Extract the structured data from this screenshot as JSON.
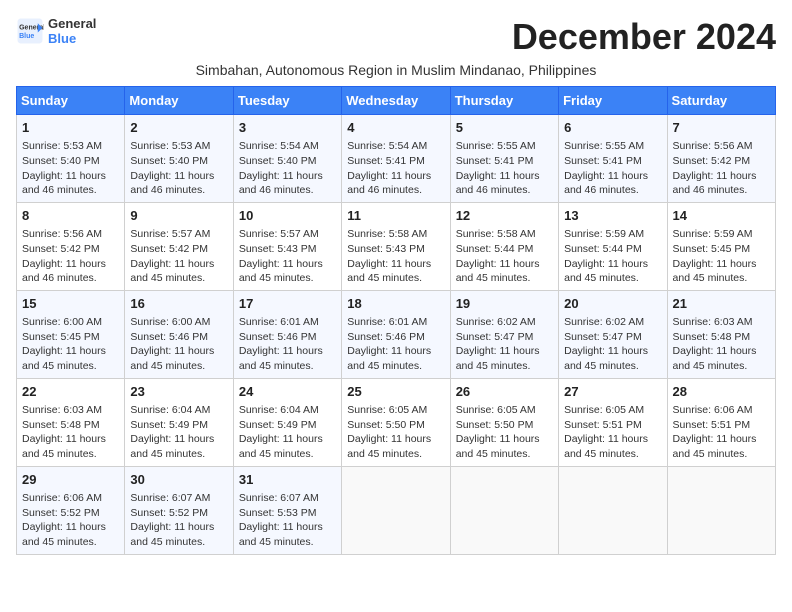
{
  "header": {
    "logo_line1": "General",
    "logo_line2": "Blue",
    "month_title": "December 2024",
    "subtitle": "Simbahan, Autonomous Region in Muslim Mindanao, Philippines"
  },
  "days_of_week": [
    "Sunday",
    "Monday",
    "Tuesday",
    "Wednesday",
    "Thursday",
    "Friday",
    "Saturday"
  ],
  "weeks": [
    [
      {
        "day": "1",
        "sunrise": "Sunrise: 5:53 AM",
        "sunset": "Sunset: 5:40 PM",
        "daylight": "Daylight: 11 hours and 46 minutes."
      },
      {
        "day": "2",
        "sunrise": "Sunrise: 5:53 AM",
        "sunset": "Sunset: 5:40 PM",
        "daylight": "Daylight: 11 hours and 46 minutes."
      },
      {
        "day": "3",
        "sunrise": "Sunrise: 5:54 AM",
        "sunset": "Sunset: 5:40 PM",
        "daylight": "Daylight: 11 hours and 46 minutes."
      },
      {
        "day": "4",
        "sunrise": "Sunrise: 5:54 AM",
        "sunset": "Sunset: 5:41 PM",
        "daylight": "Daylight: 11 hours and 46 minutes."
      },
      {
        "day": "5",
        "sunrise": "Sunrise: 5:55 AM",
        "sunset": "Sunset: 5:41 PM",
        "daylight": "Daylight: 11 hours and 46 minutes."
      },
      {
        "day": "6",
        "sunrise": "Sunrise: 5:55 AM",
        "sunset": "Sunset: 5:41 PM",
        "daylight": "Daylight: 11 hours and 46 minutes."
      },
      {
        "day": "7",
        "sunrise": "Sunrise: 5:56 AM",
        "sunset": "Sunset: 5:42 PM",
        "daylight": "Daylight: 11 hours and 46 minutes."
      }
    ],
    [
      {
        "day": "8",
        "sunrise": "Sunrise: 5:56 AM",
        "sunset": "Sunset: 5:42 PM",
        "daylight": "Daylight: 11 hours and 46 minutes."
      },
      {
        "day": "9",
        "sunrise": "Sunrise: 5:57 AM",
        "sunset": "Sunset: 5:42 PM",
        "daylight": "Daylight: 11 hours and 45 minutes."
      },
      {
        "day": "10",
        "sunrise": "Sunrise: 5:57 AM",
        "sunset": "Sunset: 5:43 PM",
        "daylight": "Daylight: 11 hours and 45 minutes."
      },
      {
        "day": "11",
        "sunrise": "Sunrise: 5:58 AM",
        "sunset": "Sunset: 5:43 PM",
        "daylight": "Daylight: 11 hours and 45 minutes."
      },
      {
        "day": "12",
        "sunrise": "Sunrise: 5:58 AM",
        "sunset": "Sunset: 5:44 PM",
        "daylight": "Daylight: 11 hours and 45 minutes."
      },
      {
        "day": "13",
        "sunrise": "Sunrise: 5:59 AM",
        "sunset": "Sunset: 5:44 PM",
        "daylight": "Daylight: 11 hours and 45 minutes."
      },
      {
        "day": "14",
        "sunrise": "Sunrise: 5:59 AM",
        "sunset": "Sunset: 5:45 PM",
        "daylight": "Daylight: 11 hours and 45 minutes."
      }
    ],
    [
      {
        "day": "15",
        "sunrise": "Sunrise: 6:00 AM",
        "sunset": "Sunset: 5:45 PM",
        "daylight": "Daylight: 11 hours and 45 minutes."
      },
      {
        "day": "16",
        "sunrise": "Sunrise: 6:00 AM",
        "sunset": "Sunset: 5:46 PM",
        "daylight": "Daylight: 11 hours and 45 minutes."
      },
      {
        "day": "17",
        "sunrise": "Sunrise: 6:01 AM",
        "sunset": "Sunset: 5:46 PM",
        "daylight": "Daylight: 11 hours and 45 minutes."
      },
      {
        "day": "18",
        "sunrise": "Sunrise: 6:01 AM",
        "sunset": "Sunset: 5:46 PM",
        "daylight": "Daylight: 11 hours and 45 minutes."
      },
      {
        "day": "19",
        "sunrise": "Sunrise: 6:02 AM",
        "sunset": "Sunset: 5:47 PM",
        "daylight": "Daylight: 11 hours and 45 minutes."
      },
      {
        "day": "20",
        "sunrise": "Sunrise: 6:02 AM",
        "sunset": "Sunset: 5:47 PM",
        "daylight": "Daylight: 11 hours and 45 minutes."
      },
      {
        "day": "21",
        "sunrise": "Sunrise: 6:03 AM",
        "sunset": "Sunset: 5:48 PM",
        "daylight": "Daylight: 11 hours and 45 minutes."
      }
    ],
    [
      {
        "day": "22",
        "sunrise": "Sunrise: 6:03 AM",
        "sunset": "Sunset: 5:48 PM",
        "daylight": "Daylight: 11 hours and 45 minutes."
      },
      {
        "day": "23",
        "sunrise": "Sunrise: 6:04 AM",
        "sunset": "Sunset: 5:49 PM",
        "daylight": "Daylight: 11 hours and 45 minutes."
      },
      {
        "day": "24",
        "sunrise": "Sunrise: 6:04 AM",
        "sunset": "Sunset: 5:49 PM",
        "daylight": "Daylight: 11 hours and 45 minutes."
      },
      {
        "day": "25",
        "sunrise": "Sunrise: 6:05 AM",
        "sunset": "Sunset: 5:50 PM",
        "daylight": "Daylight: 11 hours and 45 minutes."
      },
      {
        "day": "26",
        "sunrise": "Sunrise: 6:05 AM",
        "sunset": "Sunset: 5:50 PM",
        "daylight": "Daylight: 11 hours and 45 minutes."
      },
      {
        "day": "27",
        "sunrise": "Sunrise: 6:05 AM",
        "sunset": "Sunset: 5:51 PM",
        "daylight": "Daylight: 11 hours and 45 minutes."
      },
      {
        "day": "28",
        "sunrise": "Sunrise: 6:06 AM",
        "sunset": "Sunset: 5:51 PM",
        "daylight": "Daylight: 11 hours and 45 minutes."
      }
    ],
    [
      {
        "day": "29",
        "sunrise": "Sunrise: 6:06 AM",
        "sunset": "Sunset: 5:52 PM",
        "daylight": "Daylight: 11 hours and 45 minutes."
      },
      {
        "day": "30",
        "sunrise": "Sunrise: 6:07 AM",
        "sunset": "Sunset: 5:52 PM",
        "daylight": "Daylight: 11 hours and 45 minutes."
      },
      {
        "day": "31",
        "sunrise": "Sunrise: 6:07 AM",
        "sunset": "Sunset: 5:53 PM",
        "daylight": "Daylight: 11 hours and 45 minutes."
      },
      null,
      null,
      null,
      null
    ]
  ]
}
